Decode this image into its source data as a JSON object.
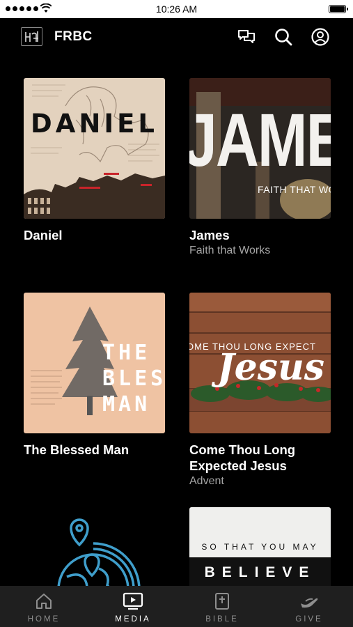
{
  "status_bar": {
    "time": "10:26 AM"
  },
  "header": {
    "title": "FRBC"
  },
  "cards": [
    {
      "title": "Daniel",
      "subtitle": "",
      "art_text": "DANIEL"
    },
    {
      "title": "James",
      "subtitle": "Faith that Works",
      "art_text": "JAMES",
      "art_subtext": "FAITH THAT WOI"
    },
    {
      "title": "The Blessed Man",
      "subtitle": "",
      "art_lines": [
        "THE",
        "BLESSI",
        "MAN"
      ]
    },
    {
      "title": "Come Thou Long Expected Jesus",
      "subtitle": "Advent",
      "art_text": "Jesus",
      "art_subtext": "OME THOU LONG EXPECT"
    },
    {
      "title": "",
      "subtitle": ""
    },
    {
      "title": "",
      "subtitle": "",
      "art_text_top": "SO THAT YOU MAY",
      "art_text_bottom": "BELIEVE"
    }
  ],
  "tabs": [
    {
      "label": "HOME",
      "icon": "home-icon",
      "active": false
    },
    {
      "label": "MEDIA",
      "icon": "media-icon",
      "active": true
    },
    {
      "label": "BIBLE",
      "icon": "bible-icon",
      "active": false
    },
    {
      "label": "GIVE",
      "icon": "give-icon",
      "active": false
    }
  ],
  "colors": {
    "background": "#000000",
    "tab_bar": "#1f1f1f",
    "subtitle": "#a5a5a5",
    "globe_accent": "#3f9ecb"
  }
}
